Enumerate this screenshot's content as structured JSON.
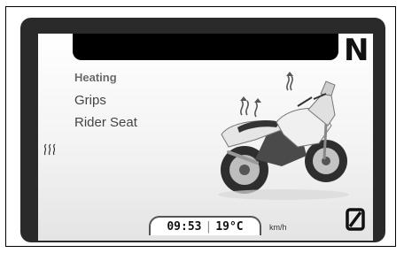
{
  "display": {
    "gear": "N",
    "menu": {
      "title": "Heating",
      "items": [
        "Grips",
        "Rider Seat"
      ]
    },
    "status": {
      "clock": "09:53",
      "separator": "|",
      "temperature": "19°C"
    },
    "speed_unit": "km/h",
    "speed_digit": "0"
  },
  "icons": [
    "heat-waves-icon",
    "motorcycle-illustration"
  ],
  "colors": {
    "bezel": "#2a2a2a",
    "screen": "#f2f2f2",
    "text": "#444444"
  }
}
